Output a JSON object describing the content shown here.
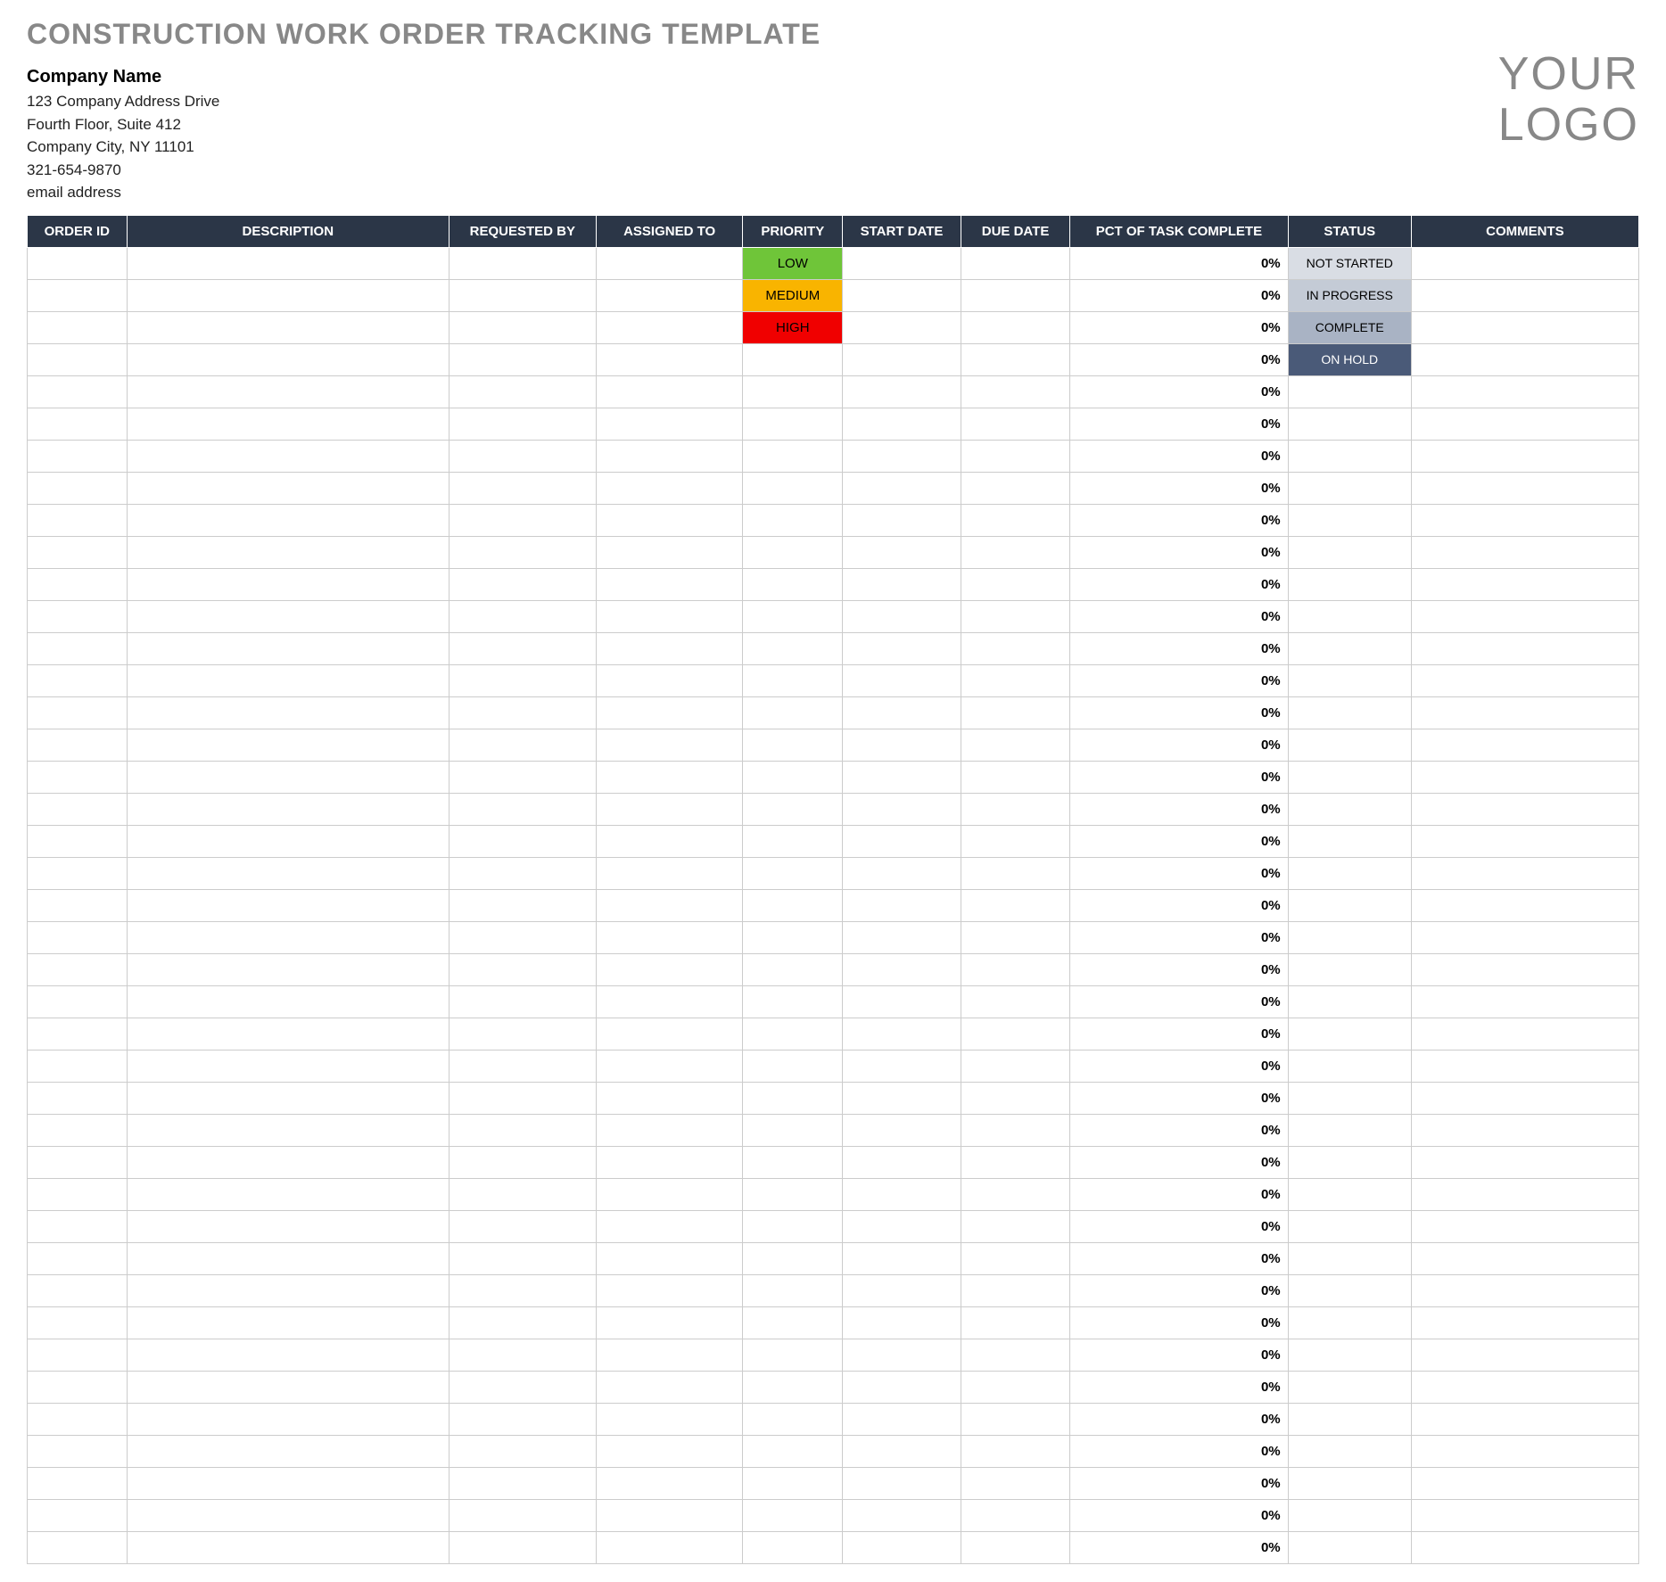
{
  "title": "CONSTRUCTION WORK ORDER TRACKING TEMPLATE",
  "company": {
    "name": "Company Name",
    "address1": "123 Company Address Drive",
    "address2": "Fourth Floor, Suite 412",
    "city_state_zip": "Company City, NY  11101",
    "phone": "321-654-9870",
    "email": "email address"
  },
  "logo": {
    "line1": "YOUR",
    "line2": "LOGO"
  },
  "columns": [
    "ORDER ID",
    "DESCRIPTION",
    "REQUESTED BY",
    "ASSIGNED TO",
    "PRIORITY",
    "START DATE",
    "DUE DATE",
    "PCT OF TASK COMPLETE",
    "STATUS",
    "COMMENTS"
  ],
  "rows": [
    {
      "order_id": "",
      "description": "",
      "requested_by": "",
      "assigned_to": "",
      "priority": "LOW",
      "priority_class": "priority-low",
      "start_date": "",
      "due_date": "",
      "pct": "0%",
      "status": "NOT STARTED",
      "status_class": "status-notstarted",
      "comments": ""
    },
    {
      "order_id": "",
      "description": "",
      "requested_by": "",
      "assigned_to": "",
      "priority": "MEDIUM",
      "priority_class": "priority-medium",
      "start_date": "",
      "due_date": "",
      "pct": "0%",
      "status": "IN PROGRESS",
      "status_class": "status-inprogress",
      "comments": ""
    },
    {
      "order_id": "",
      "description": "",
      "requested_by": "",
      "assigned_to": "",
      "priority": "HIGH",
      "priority_class": "priority-high",
      "start_date": "",
      "due_date": "",
      "pct": "0%",
      "status": "COMPLETE",
      "status_class": "status-complete",
      "comments": ""
    },
    {
      "order_id": "",
      "description": "",
      "requested_by": "",
      "assigned_to": "",
      "priority": "",
      "priority_class": "",
      "start_date": "",
      "due_date": "",
      "pct": "0%",
      "status": "ON HOLD",
      "status_class": "status-onhold",
      "comments": ""
    },
    {
      "order_id": "",
      "description": "",
      "requested_by": "",
      "assigned_to": "",
      "priority": "",
      "priority_class": "",
      "start_date": "",
      "due_date": "",
      "pct": "0%",
      "status": "",
      "status_class": "",
      "comments": ""
    },
    {
      "order_id": "",
      "description": "",
      "requested_by": "",
      "assigned_to": "",
      "priority": "",
      "priority_class": "",
      "start_date": "",
      "due_date": "",
      "pct": "0%",
      "status": "",
      "status_class": "",
      "comments": ""
    },
    {
      "order_id": "",
      "description": "",
      "requested_by": "",
      "assigned_to": "",
      "priority": "",
      "priority_class": "",
      "start_date": "",
      "due_date": "",
      "pct": "0%",
      "status": "",
      "status_class": "",
      "comments": ""
    },
    {
      "order_id": "",
      "description": "",
      "requested_by": "",
      "assigned_to": "",
      "priority": "",
      "priority_class": "",
      "start_date": "",
      "due_date": "",
      "pct": "0%",
      "status": "",
      "status_class": "",
      "comments": ""
    },
    {
      "order_id": "",
      "description": "",
      "requested_by": "",
      "assigned_to": "",
      "priority": "",
      "priority_class": "",
      "start_date": "",
      "due_date": "",
      "pct": "0%",
      "status": "",
      "status_class": "",
      "comments": ""
    },
    {
      "order_id": "",
      "description": "",
      "requested_by": "",
      "assigned_to": "",
      "priority": "",
      "priority_class": "",
      "start_date": "",
      "due_date": "",
      "pct": "0%",
      "status": "",
      "status_class": "",
      "comments": ""
    },
    {
      "order_id": "",
      "description": "",
      "requested_by": "",
      "assigned_to": "",
      "priority": "",
      "priority_class": "",
      "start_date": "",
      "due_date": "",
      "pct": "0%",
      "status": "",
      "status_class": "",
      "comments": ""
    },
    {
      "order_id": "",
      "description": "",
      "requested_by": "",
      "assigned_to": "",
      "priority": "",
      "priority_class": "",
      "start_date": "",
      "due_date": "",
      "pct": "0%",
      "status": "",
      "status_class": "",
      "comments": ""
    },
    {
      "order_id": "",
      "description": "",
      "requested_by": "",
      "assigned_to": "",
      "priority": "",
      "priority_class": "",
      "start_date": "",
      "due_date": "",
      "pct": "0%",
      "status": "",
      "status_class": "",
      "comments": ""
    },
    {
      "order_id": "",
      "description": "",
      "requested_by": "",
      "assigned_to": "",
      "priority": "",
      "priority_class": "",
      "start_date": "",
      "due_date": "",
      "pct": "0%",
      "status": "",
      "status_class": "",
      "comments": ""
    },
    {
      "order_id": "",
      "description": "",
      "requested_by": "",
      "assigned_to": "",
      "priority": "",
      "priority_class": "",
      "start_date": "",
      "due_date": "",
      "pct": "0%",
      "status": "",
      "status_class": "",
      "comments": ""
    },
    {
      "order_id": "",
      "description": "",
      "requested_by": "",
      "assigned_to": "",
      "priority": "",
      "priority_class": "",
      "start_date": "",
      "due_date": "",
      "pct": "0%",
      "status": "",
      "status_class": "",
      "comments": ""
    },
    {
      "order_id": "",
      "description": "",
      "requested_by": "",
      "assigned_to": "",
      "priority": "",
      "priority_class": "",
      "start_date": "",
      "due_date": "",
      "pct": "0%",
      "status": "",
      "status_class": "",
      "comments": ""
    },
    {
      "order_id": "",
      "description": "",
      "requested_by": "",
      "assigned_to": "",
      "priority": "",
      "priority_class": "",
      "start_date": "",
      "due_date": "",
      "pct": "0%",
      "status": "",
      "status_class": "",
      "comments": ""
    },
    {
      "order_id": "",
      "description": "",
      "requested_by": "",
      "assigned_to": "",
      "priority": "",
      "priority_class": "",
      "start_date": "",
      "due_date": "",
      "pct": "0%",
      "status": "",
      "status_class": "",
      "comments": ""
    },
    {
      "order_id": "",
      "description": "",
      "requested_by": "",
      "assigned_to": "",
      "priority": "",
      "priority_class": "",
      "start_date": "",
      "due_date": "",
      "pct": "0%",
      "status": "",
      "status_class": "",
      "comments": ""
    },
    {
      "order_id": "",
      "description": "",
      "requested_by": "",
      "assigned_to": "",
      "priority": "",
      "priority_class": "",
      "start_date": "",
      "due_date": "",
      "pct": "0%",
      "status": "",
      "status_class": "",
      "comments": ""
    },
    {
      "order_id": "",
      "description": "",
      "requested_by": "",
      "assigned_to": "",
      "priority": "",
      "priority_class": "",
      "start_date": "",
      "due_date": "",
      "pct": "0%",
      "status": "",
      "status_class": "",
      "comments": ""
    },
    {
      "order_id": "",
      "description": "",
      "requested_by": "",
      "assigned_to": "",
      "priority": "",
      "priority_class": "",
      "start_date": "",
      "due_date": "",
      "pct": "0%",
      "status": "",
      "status_class": "",
      "comments": ""
    },
    {
      "order_id": "",
      "description": "",
      "requested_by": "",
      "assigned_to": "",
      "priority": "",
      "priority_class": "",
      "start_date": "",
      "due_date": "",
      "pct": "0%",
      "status": "",
      "status_class": "",
      "comments": ""
    },
    {
      "order_id": "",
      "description": "",
      "requested_by": "",
      "assigned_to": "",
      "priority": "",
      "priority_class": "",
      "start_date": "",
      "due_date": "",
      "pct": "0%",
      "status": "",
      "status_class": "",
      "comments": ""
    },
    {
      "order_id": "",
      "description": "",
      "requested_by": "",
      "assigned_to": "",
      "priority": "",
      "priority_class": "",
      "start_date": "",
      "due_date": "",
      "pct": "0%",
      "status": "",
      "status_class": "",
      "comments": ""
    },
    {
      "order_id": "",
      "description": "",
      "requested_by": "",
      "assigned_to": "",
      "priority": "",
      "priority_class": "",
      "start_date": "",
      "due_date": "",
      "pct": "0%",
      "status": "",
      "status_class": "",
      "comments": ""
    },
    {
      "order_id": "",
      "description": "",
      "requested_by": "",
      "assigned_to": "",
      "priority": "",
      "priority_class": "",
      "start_date": "",
      "due_date": "",
      "pct": "0%",
      "status": "",
      "status_class": "",
      "comments": ""
    },
    {
      "order_id": "",
      "description": "",
      "requested_by": "",
      "assigned_to": "",
      "priority": "",
      "priority_class": "",
      "start_date": "",
      "due_date": "",
      "pct": "0%",
      "status": "",
      "status_class": "",
      "comments": ""
    },
    {
      "order_id": "",
      "description": "",
      "requested_by": "",
      "assigned_to": "",
      "priority": "",
      "priority_class": "",
      "start_date": "",
      "due_date": "",
      "pct": "0%",
      "status": "",
      "status_class": "",
      "comments": ""
    },
    {
      "order_id": "",
      "description": "",
      "requested_by": "",
      "assigned_to": "",
      "priority": "",
      "priority_class": "",
      "start_date": "",
      "due_date": "",
      "pct": "0%",
      "status": "",
      "status_class": "",
      "comments": ""
    },
    {
      "order_id": "",
      "description": "",
      "requested_by": "",
      "assigned_to": "",
      "priority": "",
      "priority_class": "",
      "start_date": "",
      "due_date": "",
      "pct": "0%",
      "status": "",
      "status_class": "",
      "comments": ""
    },
    {
      "order_id": "",
      "description": "",
      "requested_by": "",
      "assigned_to": "",
      "priority": "",
      "priority_class": "",
      "start_date": "",
      "due_date": "",
      "pct": "0%",
      "status": "",
      "status_class": "",
      "comments": ""
    },
    {
      "order_id": "",
      "description": "",
      "requested_by": "",
      "assigned_to": "",
      "priority": "",
      "priority_class": "",
      "start_date": "",
      "due_date": "",
      "pct": "0%",
      "status": "",
      "status_class": "",
      "comments": ""
    },
    {
      "order_id": "",
      "description": "",
      "requested_by": "",
      "assigned_to": "",
      "priority": "",
      "priority_class": "",
      "start_date": "",
      "due_date": "",
      "pct": "0%",
      "status": "",
      "status_class": "",
      "comments": ""
    },
    {
      "order_id": "",
      "description": "",
      "requested_by": "",
      "assigned_to": "",
      "priority": "",
      "priority_class": "",
      "start_date": "",
      "due_date": "",
      "pct": "0%",
      "status": "",
      "status_class": "",
      "comments": ""
    },
    {
      "order_id": "",
      "description": "",
      "requested_by": "",
      "assigned_to": "",
      "priority": "",
      "priority_class": "",
      "start_date": "",
      "due_date": "",
      "pct": "0%",
      "status": "",
      "status_class": "",
      "comments": ""
    },
    {
      "order_id": "",
      "description": "",
      "requested_by": "",
      "assigned_to": "",
      "priority": "",
      "priority_class": "",
      "start_date": "",
      "due_date": "",
      "pct": "0%",
      "status": "",
      "status_class": "",
      "comments": ""
    },
    {
      "order_id": "",
      "description": "",
      "requested_by": "",
      "assigned_to": "",
      "priority": "",
      "priority_class": "",
      "start_date": "",
      "due_date": "",
      "pct": "0%",
      "status": "",
      "status_class": "",
      "comments": ""
    },
    {
      "order_id": "",
      "description": "",
      "requested_by": "",
      "assigned_to": "",
      "priority": "",
      "priority_class": "",
      "start_date": "",
      "due_date": "",
      "pct": "0%",
      "status": "",
      "status_class": "",
      "comments": ""
    },
    {
      "order_id": "",
      "description": "",
      "requested_by": "",
      "assigned_to": "",
      "priority": "",
      "priority_class": "",
      "start_date": "",
      "due_date": "",
      "pct": "0%",
      "status": "",
      "status_class": "",
      "comments": ""
    }
  ]
}
